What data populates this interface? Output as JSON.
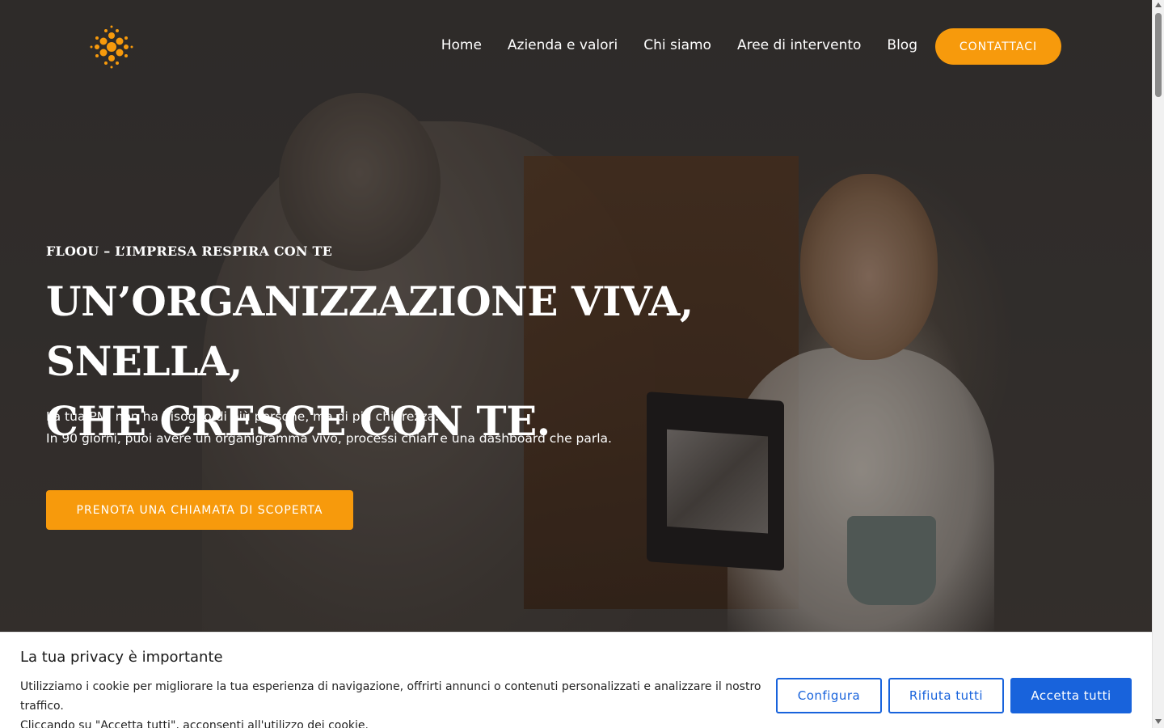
{
  "header": {
    "logo_icon": "orange-dot-sunburst-logo",
    "nav": [
      {
        "label": "Home"
      },
      {
        "label": "Azienda e valori"
      },
      {
        "label": "Chi siamo"
      },
      {
        "label": "Aree di intervento"
      },
      {
        "label": "Blog"
      }
    ],
    "contact_button": "CONTATTACI"
  },
  "hero": {
    "eyebrow": "FLOOU – L’IMPRESA RESPIRA CON TE",
    "headline_line1": "UN’ORGANIZZAZIONE VIVA, SNELLA,",
    "headline_line2": "CHE CRESCE CON TE.",
    "sub_line1": "La tua PMI non ha bisogno di più persone, ma di più chiarezza.",
    "sub_line2": "In 90 giorni, puoi avere un organigramma vivo, processi chiari e una dashboard che parla.",
    "cta_button": "PRENOTA UNA CHIAMATA DI SCOPERTA"
  },
  "cookie_banner": {
    "title": "La tua privacy è importante",
    "text_line1": "Utilizziamo i cookie per migliorare la tua esperienza di navigazione, offrirti annunci o contenuti personalizzati e analizzare il nostro traffico.",
    "text_line2": "Cliccando su \"Accetta tutti\", acconsenti all'utilizzo dei cookie.",
    "configure_button": "Configura",
    "reject_button": "Rifiuta tutti",
    "accept_button": "Accetta tutti"
  },
  "colors": {
    "accent_orange": "#f79a0c",
    "cookie_blue": "#1863dc"
  }
}
